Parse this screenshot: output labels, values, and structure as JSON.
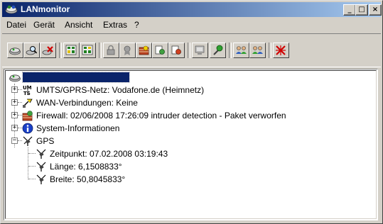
{
  "window": {
    "title": "LANmonitor",
    "controls": {
      "minimize": "_",
      "maximize": "□",
      "close": "×"
    }
  },
  "menu": [
    "Datei",
    "Gerät",
    "Ansicht",
    "Extras",
    "?"
  ],
  "toolbar": {
    "buttons": [
      "device-icon",
      "search-device-icon",
      "delete-icon",
      "trace-icon",
      "trace2-icon",
      "lock-icon",
      "certificate-icon",
      "firewall-icon",
      "vpn-icon",
      "vpn2-icon",
      "monitor-icon",
      "config-icon",
      "users-icon",
      "users2-icon",
      "disconnect-icon"
    ]
  },
  "tree": {
    "root_label": "",
    "items": [
      {
        "label": "UMTS/GPRS-Netz: Vodafone.de (Heimnetz)",
        "icon": "umts-icon"
      },
      {
        "label": "WAN-Verbindungen: Keine",
        "icon": "wan-icon"
      },
      {
        "label": "Firewall: 02/06/2008 17:26:09 intruder detection - Paket verworfen",
        "icon": "firewall-icon"
      },
      {
        "label": "System-Informationen",
        "icon": "info-icon"
      },
      {
        "label": "GPS",
        "icon": "gps-icon"
      }
    ],
    "gps_children": [
      {
        "label": "Zeitpunkt: 07.02.2008 03:19:43",
        "icon": "gps-icon"
      },
      {
        "label": "Länge: 6,1508833°",
        "icon": "gps-icon"
      },
      {
        "label": "Breite: 50,8045833°",
        "icon": "gps-icon"
      }
    ]
  }
}
